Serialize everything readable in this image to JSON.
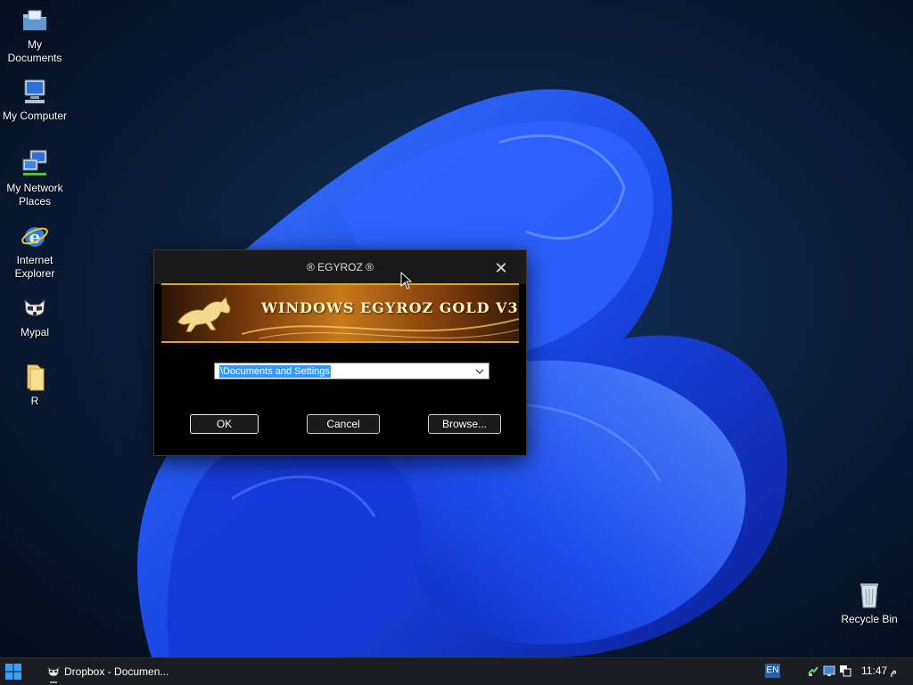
{
  "desktop": {
    "icons": [
      {
        "label": "My\nDocuments"
      },
      {
        "label": "My Computer"
      },
      {
        "label": "My Network\nPlaces"
      },
      {
        "label": "Internet\nExplorer"
      },
      {
        "label": "Mypal"
      },
      {
        "label": "R"
      },
      {
        "label": "Recycle Bin"
      }
    ]
  },
  "dialog": {
    "title": "® EGYROZ ®",
    "banner_text": "WINDOWS EGYROZ GOLD V3",
    "combo_value": "\\Documents and Settings",
    "ok_label": "OK",
    "cancel_label": "Cancel",
    "browse_label": "Browse..."
  },
  "taskbar": {
    "task_label": "Dropbox - Documen...",
    "language": "EN",
    "clock": "11:47 م"
  },
  "colors": {
    "accent": "#3399ff",
    "wallpaper_blue": "#1d4fe0",
    "taskbar": "#1b1d22"
  }
}
